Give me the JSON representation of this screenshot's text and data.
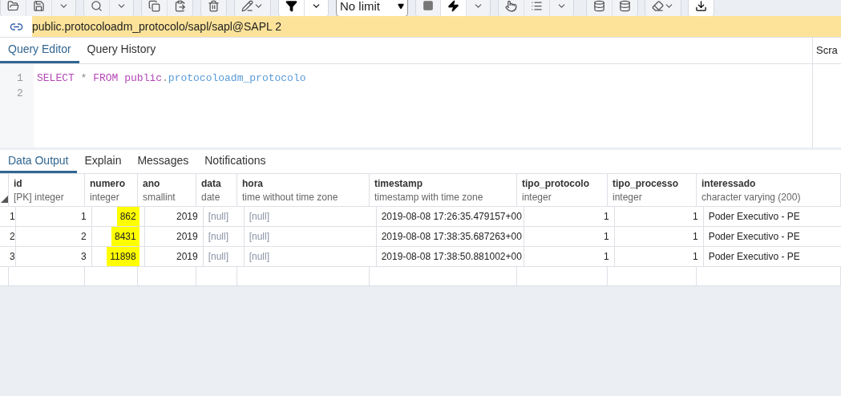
{
  "toolbar": {
    "row_limit": "No limit"
  },
  "connection": {
    "title": "public.protocoloadm_protocolo/sapl/sapl@SAPL 2"
  },
  "editor_tabs": [
    {
      "label": "Query Editor",
      "selected": true
    },
    {
      "label": "Query History",
      "selected": false
    }
  ],
  "scratch_pad_tab": "Scra",
  "editor": {
    "lines": [
      [
        {
          "kind": "keyword",
          "text": "SELECT"
        },
        {
          "kind": "plain",
          "text": " * "
        },
        {
          "kind": "keyword",
          "text": "FROM public"
        },
        {
          "kind": "plain",
          "text": "."
        },
        {
          "kind": "identifier",
          "text": "protocoloadm_protocolo"
        }
      ]
    ],
    "line_numbers": [
      "1",
      "2"
    ]
  },
  "result_tabs": [
    {
      "label": "Data Output",
      "selected": true
    },
    {
      "label": "Explain",
      "selected": false
    },
    {
      "label": "Messages",
      "selected": false
    },
    {
      "label": "Notifications",
      "selected": false
    }
  ],
  "table": {
    "columns": [
      {
        "name": "id",
        "type": "[PK] integer",
        "numeric": true
      },
      {
        "name": "numero",
        "type": "integer",
        "numeric": true
      },
      {
        "name": "ano",
        "type": "smallint",
        "numeric": true
      },
      {
        "name": "data",
        "type": "date",
        "numeric": false
      },
      {
        "name": "hora",
        "type": "time without time zone",
        "numeric": false
      },
      {
        "name": "timestamp",
        "type": "timestamp with time zone",
        "numeric": false
      },
      {
        "name": "tipo_protocolo",
        "type": "integer",
        "numeric": true
      },
      {
        "name": "tipo_processo",
        "type": "integer",
        "numeric": true
      },
      {
        "name": "interessado",
        "type": "character varying (200)",
        "numeric": false
      }
    ],
    "rows": [
      {
        "row_number": "1",
        "cells": [
          {
            "text": "1",
            "is_null": false,
            "highlighted": false
          },
          {
            "text": "862",
            "is_null": false,
            "highlighted": true
          },
          {
            "text": "2019",
            "is_null": false,
            "highlighted": false
          },
          {
            "text": "[null]",
            "is_null": true,
            "highlighted": false
          },
          {
            "text": "[null]",
            "is_null": true,
            "highlighted": false
          },
          {
            "text": "2019-08-08 17:26:35.479157+00",
            "is_null": false,
            "highlighted": false
          },
          {
            "text": "1",
            "is_null": false,
            "highlighted": false
          },
          {
            "text": "1",
            "is_null": false,
            "highlighted": false
          },
          {
            "text": "Poder Executivo - PE",
            "is_null": false,
            "highlighted": false
          }
        ]
      },
      {
        "row_number": "2",
        "cells": [
          {
            "text": "2",
            "is_null": false,
            "highlighted": false
          },
          {
            "text": "8431",
            "is_null": false,
            "highlighted": true
          },
          {
            "text": "2019",
            "is_null": false,
            "highlighted": false
          },
          {
            "text": "[null]",
            "is_null": true,
            "highlighted": false
          },
          {
            "text": "[null]",
            "is_null": true,
            "highlighted": false
          },
          {
            "text": "2019-08-08 17:38:35.687263+00",
            "is_null": false,
            "highlighted": false
          },
          {
            "text": "1",
            "is_null": false,
            "highlighted": false
          },
          {
            "text": "1",
            "is_null": false,
            "highlighted": false
          },
          {
            "text": "Poder Executivo - PE",
            "is_null": false,
            "highlighted": false
          }
        ]
      },
      {
        "row_number": "3",
        "cells": [
          {
            "text": "3",
            "is_null": false,
            "highlighted": false
          },
          {
            "text": "11898",
            "is_null": false,
            "highlighted": true
          },
          {
            "text": "2019",
            "is_null": false,
            "highlighted": false
          },
          {
            "text": "[null]",
            "is_null": true,
            "highlighted": false
          },
          {
            "text": "[null]",
            "is_null": true,
            "highlighted": false
          },
          {
            "text": "2019-08-08 17:38:50.881002+00",
            "is_null": false,
            "highlighted": false
          },
          {
            "text": "1",
            "is_null": false,
            "highlighted": false
          },
          {
            "text": "1",
            "is_null": false,
            "highlighted": false
          },
          {
            "text": "Poder Executivo - PE",
            "is_null": false,
            "highlighted": false
          }
        ]
      }
    ]
  }
}
